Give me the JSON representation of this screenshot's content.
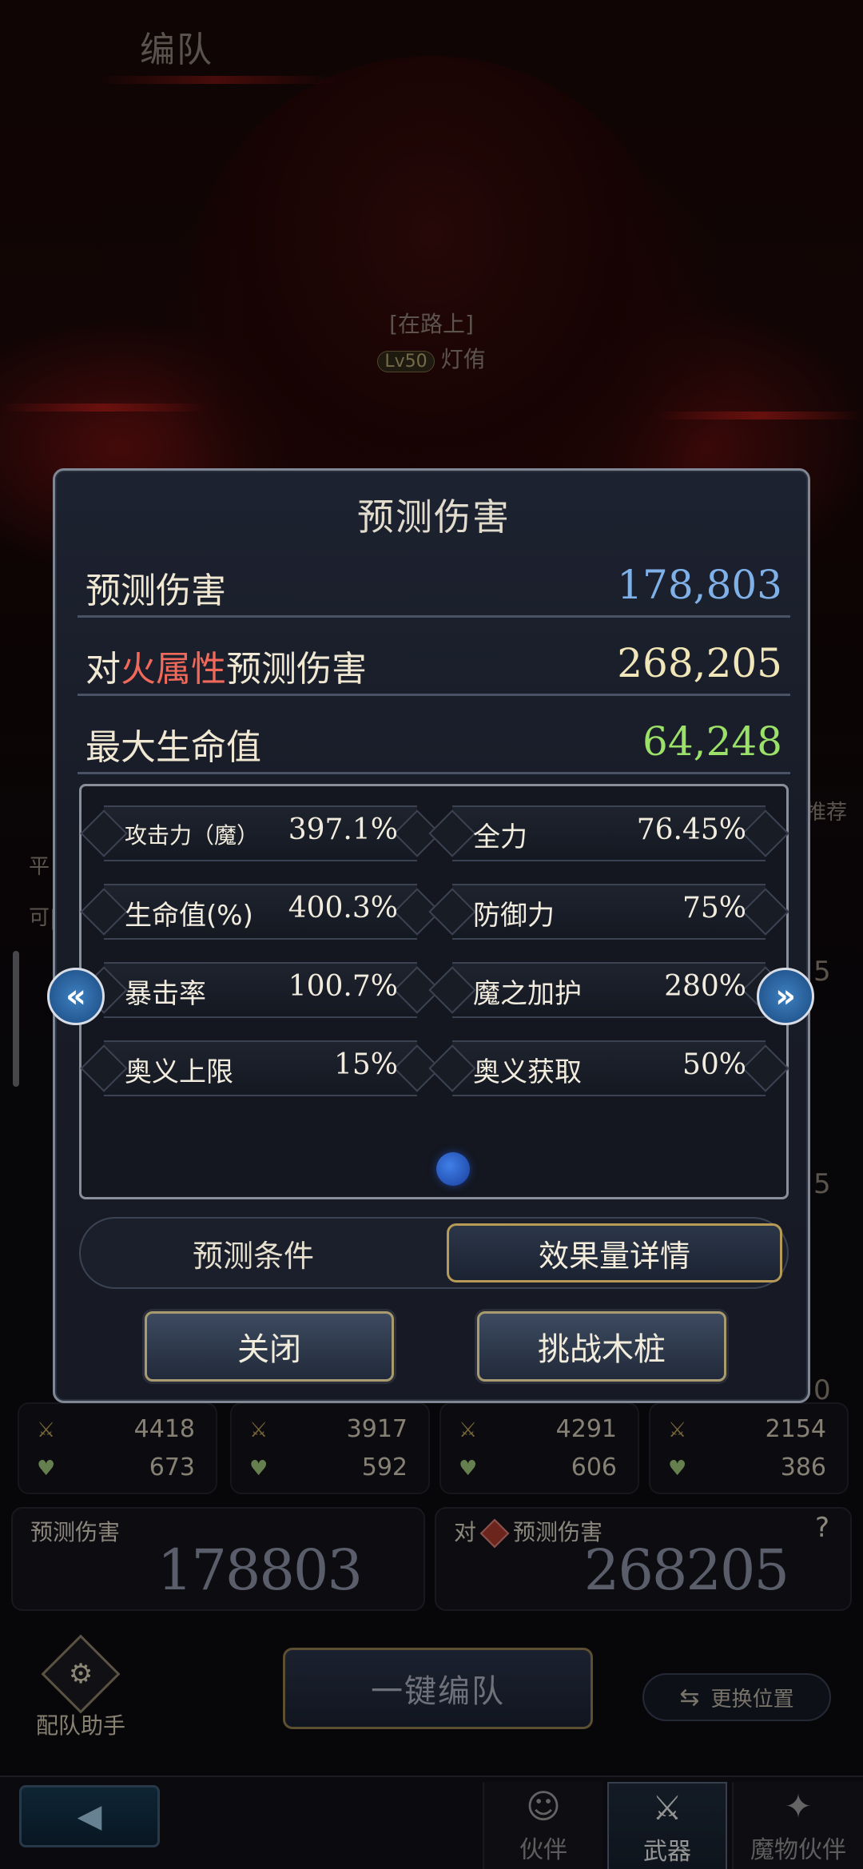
{
  "header": {
    "title": "编队"
  },
  "character": {
    "status": "[在路上]",
    "level": "Lv50",
    "name": "灯侑"
  },
  "side_fragments": {
    "left_top": "平",
    "left_mid": "可|",
    "right_text": "推荐",
    "right_num1": "5",
    "right_num2": "5",
    "right_num3": "0"
  },
  "team_slots": [
    {
      "attack": "4418",
      "hp": "673"
    },
    {
      "attack": "3917",
      "hp": "592"
    },
    {
      "attack": "4291",
      "hp": "606"
    },
    {
      "attack": "2154",
      "hp": "386"
    }
  ],
  "damage": {
    "predicted_label": "预测伤害",
    "predicted_value": "178803",
    "vs_prefix": "对",
    "vs_label": "预测伤害",
    "vs_value": "268205",
    "help": "?"
  },
  "actions": {
    "assist_label": "配队助手",
    "onekey_label": "一键编队",
    "swap_label": "更换位置"
  },
  "nav": {
    "back_icon": "back-arrow",
    "tabs": [
      {
        "label": "伙伴",
        "icon": "partner-icon"
      },
      {
        "label": "武器",
        "icon": "weapon-icon",
        "active": true
      },
      {
        "label": "魔物伙伴",
        "icon": "monster-icon"
      }
    ]
  },
  "modal": {
    "title": "预测伤害",
    "rows": [
      {
        "label": "预测伤害",
        "value": "178,803",
        "color": "#7fb0e8"
      },
      {
        "label_prefix": "对",
        "label_highlight": "火属性",
        "label_suffix": "预测伤害",
        "value": "268,205",
        "color": "#f1e6b8"
      },
      {
        "label": "最大生命值",
        "value": "64,248",
        "color": "#9be068"
      }
    ],
    "stats": [
      {
        "name": "攻击力（魔）",
        "value": "397.1%"
      },
      {
        "name": "全力",
        "value": "76.45%"
      },
      {
        "name": "生命值(%)",
        "value": "400.3%"
      },
      {
        "name": "防御力",
        "value": "75%"
      },
      {
        "name": "暴击率",
        "value": "100.7%"
      },
      {
        "name": "魔之加护",
        "value": "280%"
      },
      {
        "name": "奥义上限",
        "value": "15%"
      },
      {
        "name": "奥义获取",
        "value": "50%"
      }
    ],
    "tabs": [
      {
        "label": "预测条件",
        "active": false
      },
      {
        "label": "效果量详情",
        "active": true
      }
    ],
    "buttons": {
      "close": "关闭",
      "challenge": "挑战木桩"
    },
    "arrows": {
      "left": "«",
      "right": "»"
    }
  }
}
